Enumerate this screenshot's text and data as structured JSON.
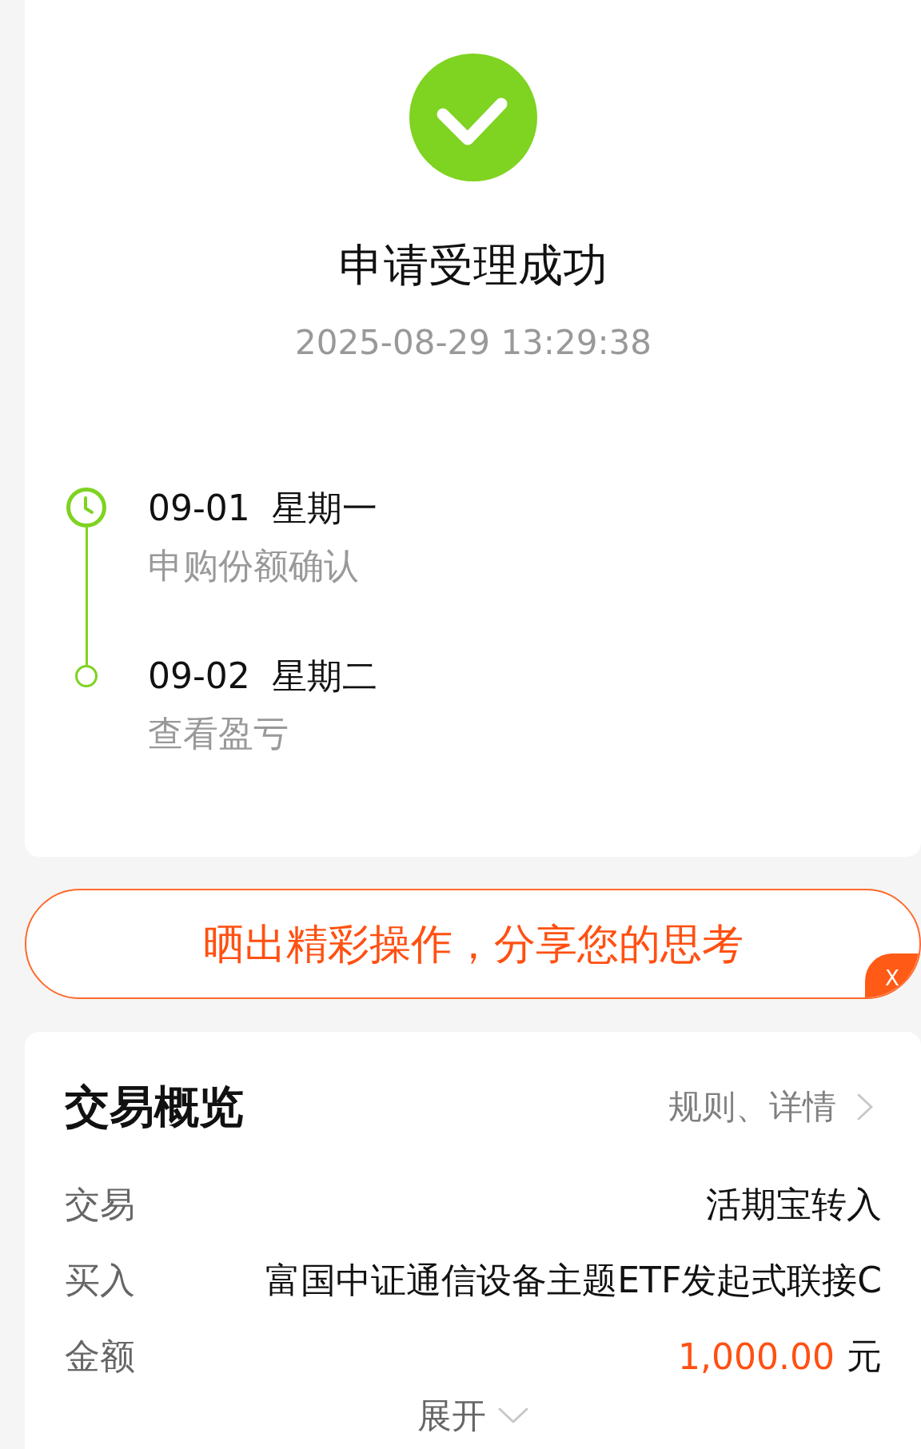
{
  "status": {
    "kind": "success",
    "title": "申请受理成功",
    "time": "2025-08-29 13:29:38"
  },
  "timeline": [
    {
      "kind": "clock",
      "date": "09-01",
      "weekday": "星期一",
      "note": "申购份额确认"
    },
    {
      "kind": "dot",
      "date": "09-02",
      "weekday": "星期二",
      "note": "查看盈亏"
    }
  ],
  "share_banner": {
    "text": "晒出精彩操作，分享您的思考",
    "close_label": "X"
  },
  "overview": {
    "title": "交易概览",
    "link": "规则、详情",
    "rows": [
      {
        "kind": "text",
        "label": "交易",
        "value": "活期宝转入"
      },
      {
        "kind": "text",
        "label": "买入",
        "value": "富国中证通信设备主题ETF发起式联接C"
      },
      {
        "kind": "amount",
        "label": "金额",
        "amount": "1,000.00",
        "unit": "元"
      }
    ],
    "expand_label": "展开"
  }
}
